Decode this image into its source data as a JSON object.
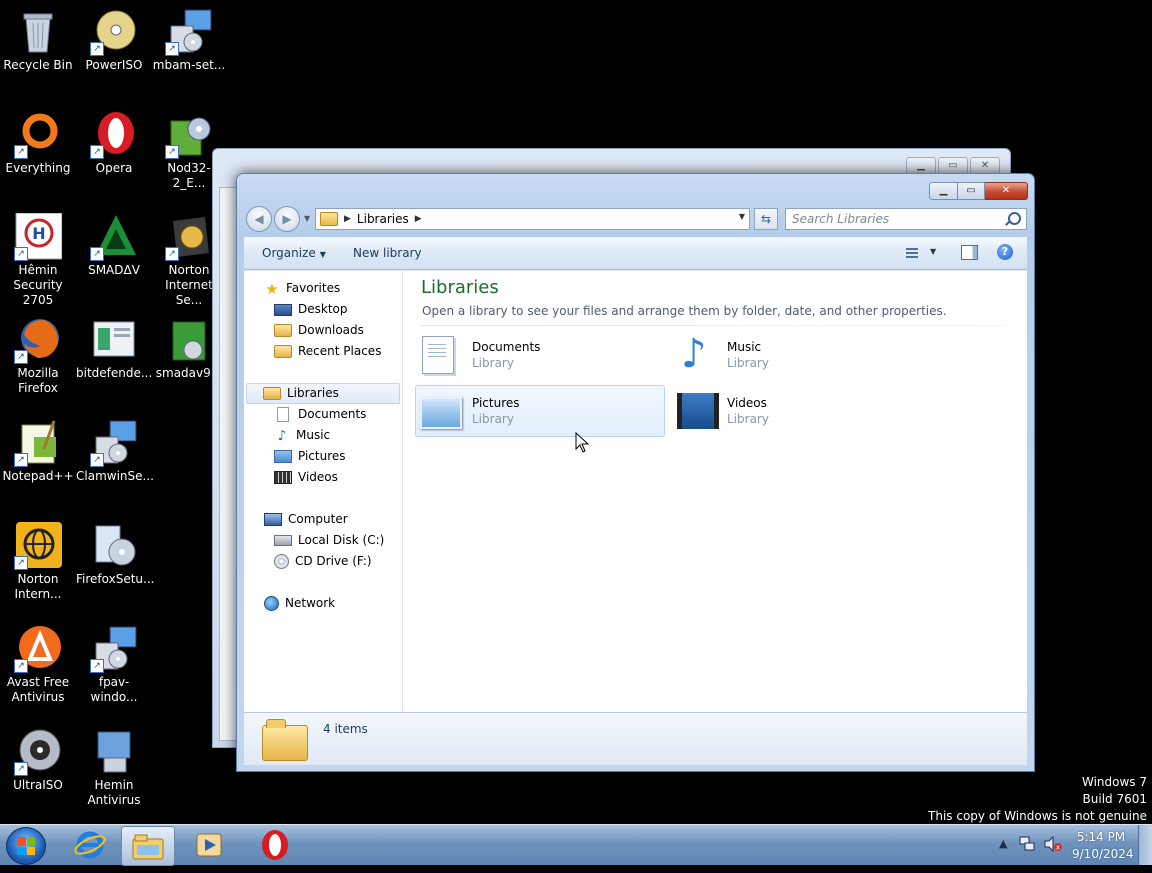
{
  "desktop": {
    "icons": [
      {
        "label": "Recycle Bin",
        "icon": "recycle-bin-icon"
      },
      {
        "label": "PowerISO",
        "icon": "poweriso-icon"
      },
      {
        "label": "mbam-set...",
        "icon": "installer-icon"
      },
      {
        "label": "Everything",
        "icon": "everything-icon"
      },
      {
        "label": "Opera",
        "icon": "opera-icon"
      },
      {
        "label": "Nod32-2_E...",
        "icon": "nod32-icon"
      },
      {
        "label": "Hêmin Security 2705",
        "icon": "hemin-security-icon"
      },
      {
        "label": "SMADΔV",
        "icon": "smadav-icon"
      },
      {
        "label": "Norton Internet Se...",
        "icon": "norton-internet-security-icon"
      },
      {
        "label": "Mozilla Firefox",
        "icon": "firefox-icon"
      },
      {
        "label": "bitdefende...",
        "icon": "bitdefender-icon"
      },
      {
        "label": "smadav9...",
        "icon": "smadav-installer-icon"
      },
      {
        "label": "Notepad++",
        "icon": "notepad-plus-plus-icon"
      },
      {
        "label": "ClamwinSe...",
        "icon": "installer-icon"
      },
      {
        "label": "Norton Intern...",
        "icon": "norton-icon"
      },
      {
        "label": "FirefoxSetu...",
        "icon": "firefox-setup-icon"
      },
      {
        "label": "Avast Free Antivirus",
        "icon": "avast-icon"
      },
      {
        "label": "fpav-windo...",
        "icon": "installer-icon"
      },
      {
        "label": "UltraISO",
        "icon": "ultraiso-icon"
      },
      {
        "label": "Hemin Antivirus",
        "icon": "hemin-antivirus-icon"
      }
    ]
  },
  "explorer": {
    "breadcrumb": "Libraries",
    "search_placeholder": "Search Libraries",
    "toolbar": {
      "organize": "Organize",
      "new_library": "New library"
    },
    "nav": {
      "favorites": "Favorites",
      "desktop": "Desktop",
      "downloads": "Downloads",
      "recent_places": "Recent Places",
      "libraries": "Libraries",
      "documents": "Documents",
      "music": "Music",
      "pictures": "Pictures",
      "videos": "Videos",
      "computer": "Computer",
      "local_disk": "Local Disk (C:)",
      "cd_drive": "CD Drive (F:)",
      "network": "Network"
    },
    "main": {
      "title": "Libraries",
      "subtitle": "Open a library to see your files and arrange them by folder, date, and other properties.",
      "tiles": [
        {
          "name": "Documents",
          "type": "Library"
        },
        {
          "name": "Music",
          "type": "Library"
        },
        {
          "name": "Pictures",
          "type": "Library"
        },
        {
          "name": "Videos",
          "type": "Library"
        }
      ]
    },
    "details": {
      "count": "4 items"
    }
  },
  "watermark": {
    "line1": "Windows 7",
    "line2": "Build 7601",
    "line3": "This copy of Windows is not genuine"
  },
  "taskbar": {
    "time": "5:14 PM",
    "date": "9/10/2024"
  },
  "colors": {
    "accent_title": "#1e6b33",
    "close_button": "#c54a2e",
    "taskbar": "#6f93bd"
  }
}
